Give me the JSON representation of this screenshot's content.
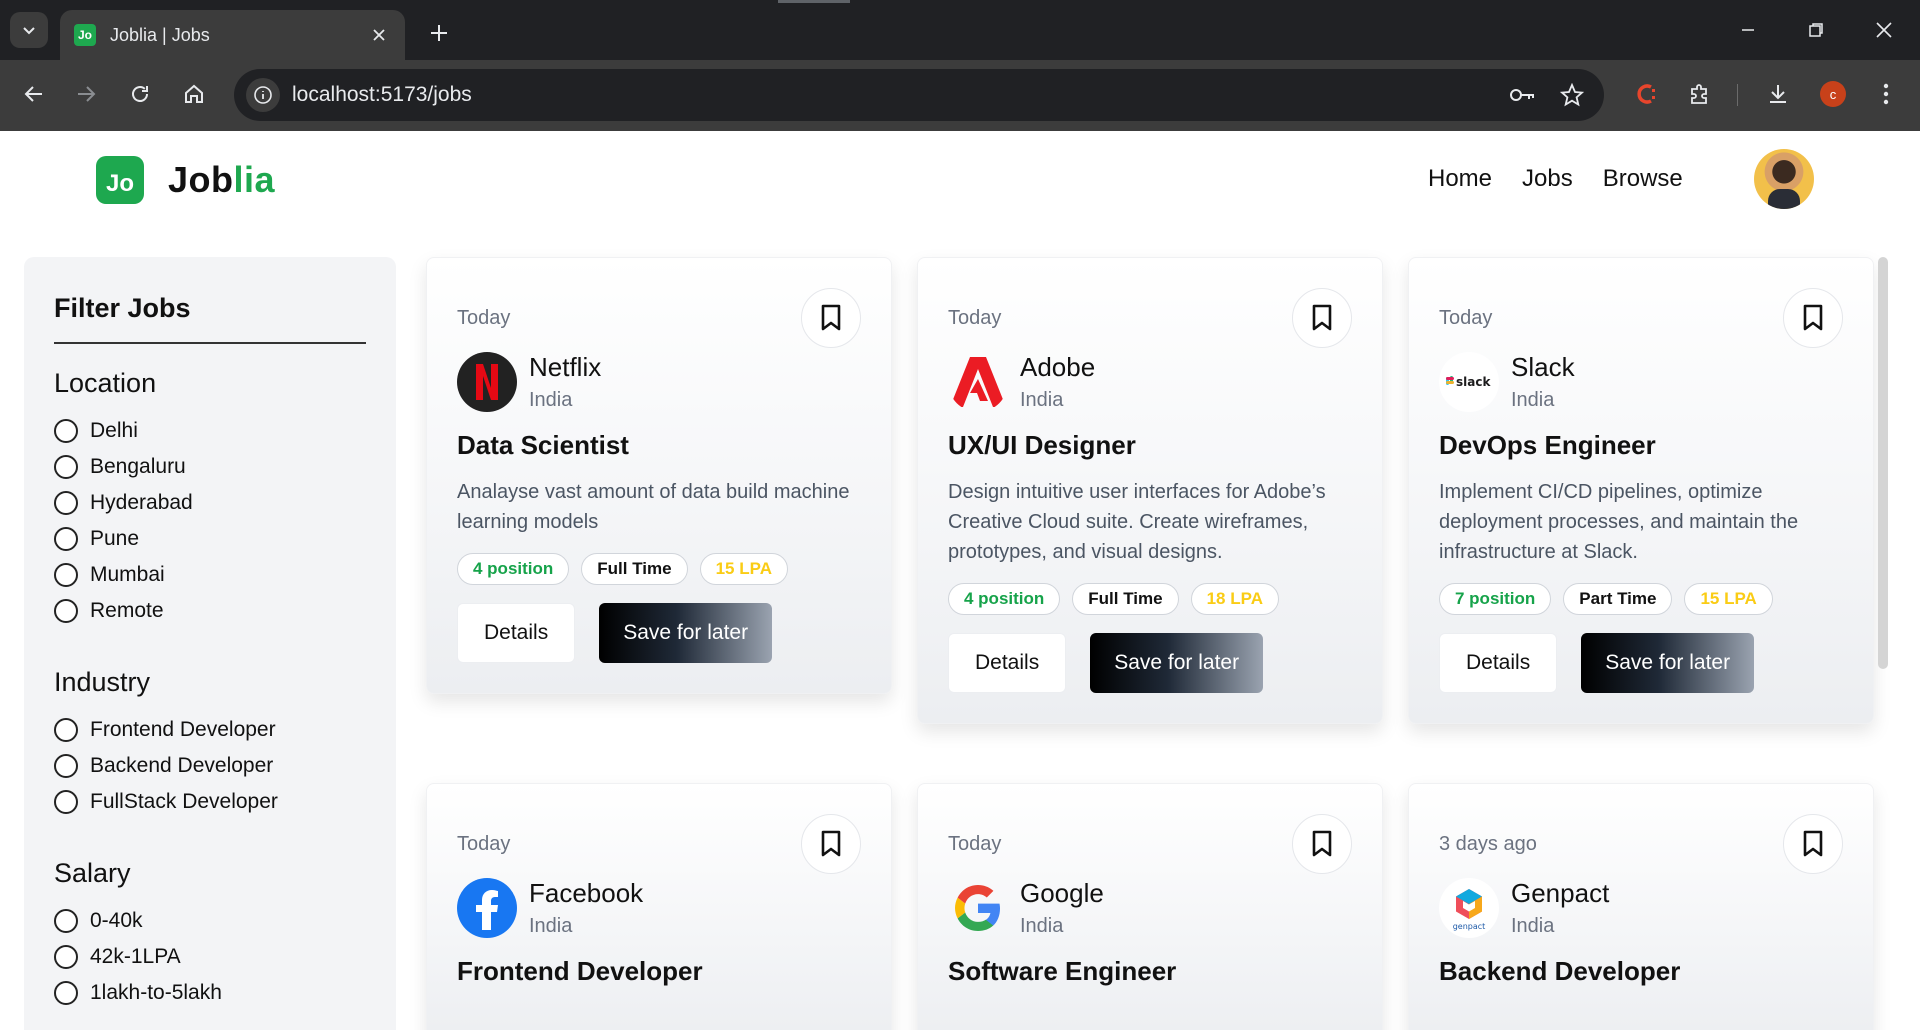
{
  "browser": {
    "tab_title": "Joblia | Jobs",
    "url": "localhost:5173/jobs",
    "profile_initial": "c"
  },
  "app": {
    "logo_mark": "Jo",
    "logo_text_a": "Job",
    "logo_text_b": "lia",
    "nav": [
      "Home",
      "Jobs",
      "Browse"
    ]
  },
  "filters": {
    "title": "Filter Jobs",
    "groups": [
      {
        "label": "Location",
        "options": [
          "Delhi",
          "Bengaluru",
          "Hyderabad",
          "Pune",
          "Mumbai",
          "Remote"
        ]
      },
      {
        "label": "Industry",
        "options": [
          "Frontend Developer",
          "Backend Developer",
          "FullStack Developer"
        ]
      },
      {
        "label": "Salary",
        "options": [
          "0-40k",
          "42k-1LPA",
          "1lakh-to-5lakh"
        ]
      }
    ]
  },
  "jobs": [
    {
      "posted": "Today",
      "company": "Netflix",
      "country": "India",
      "logo": "netflix-logo",
      "title": "Data Scientist",
      "description": "Analayse vast amount of data build machine learning models",
      "positions": "4 position",
      "type": "Full Time",
      "salary": "15 LPA",
      "details": "Details",
      "save": "Save for later"
    },
    {
      "posted": "Today",
      "company": "Adobe",
      "country": "India",
      "logo": "adobe-logo",
      "title": "UX/UI Designer",
      "description": "Design intuitive user interfaces for Adobe’s Creative Cloud suite. Create wireframes, prototypes, and visual designs.",
      "positions": "4 position",
      "type": "Full Time",
      "salary": "18 LPA",
      "details": "Details",
      "save": "Save for later"
    },
    {
      "posted": "Today",
      "company": "Slack",
      "country": "India",
      "logo": "slack-logo",
      "title": "DevOps Engineer",
      "description": "Implement CI/CD pipelines, optimize deployment processes, and maintain the infrastructure at Slack.",
      "positions": "7 position",
      "type": "Part Time",
      "salary": "15 LPA",
      "details": "Details",
      "save": "Save for later"
    },
    {
      "posted": "Today",
      "company": "Facebook",
      "country": "India",
      "logo": "facebook-logo",
      "title": "Frontend Developer"
    },
    {
      "posted": "Today",
      "company": "Google",
      "country": "India",
      "logo": "google-logo",
      "title": "Software Engineer"
    },
    {
      "posted": "3 days ago",
      "company": "Genpact",
      "country": "India",
      "logo": "genpact-logo",
      "title": "Backend Developer"
    }
  ],
  "colors": {
    "brand": "#1ea84f",
    "positions": "#16a34a",
    "salary": "#facc15"
  }
}
